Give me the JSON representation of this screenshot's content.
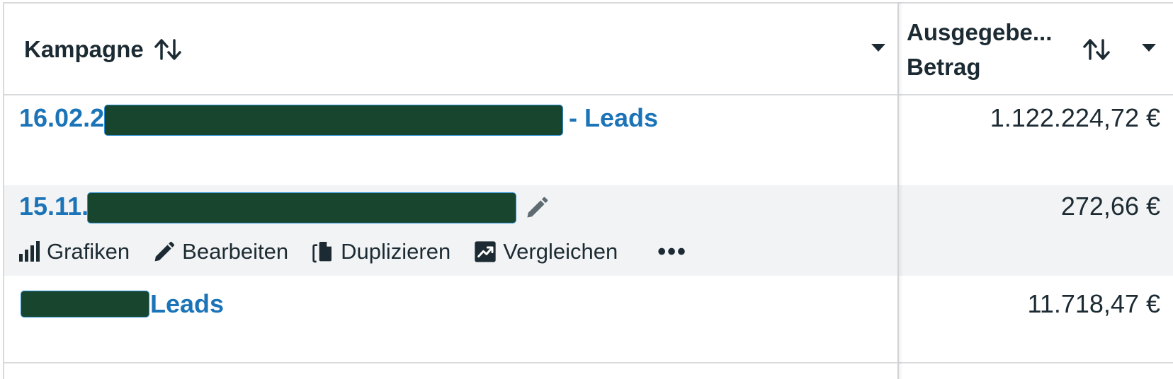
{
  "header": {
    "campaign_label": "Kampagne",
    "amount_label_line1": "Ausgegebe...",
    "amount_label_line2": "Betrag"
  },
  "rows": [
    {
      "name_prefix": "16.02.2",
      "name_suffix": "- Leads",
      "amount": "1.122.224,72 €"
    },
    {
      "name_prefix": "15.11.",
      "name_suffix": "",
      "amount": "272,66 €"
    },
    {
      "name_prefix": "",
      "name_suffix": "Leads",
      "amount": "11.718,47 €"
    }
  ],
  "row_actions": {
    "charts": "Grafiken",
    "edit": "Bearbeiten",
    "duplicate": "Duplizieren",
    "compare": "Vergleichen",
    "more": "•••"
  },
  "colors": {
    "link": "#1b74b8",
    "text": "#1c2b33",
    "hover_row": "#f2f3f4",
    "redaction": "#17452d"
  }
}
